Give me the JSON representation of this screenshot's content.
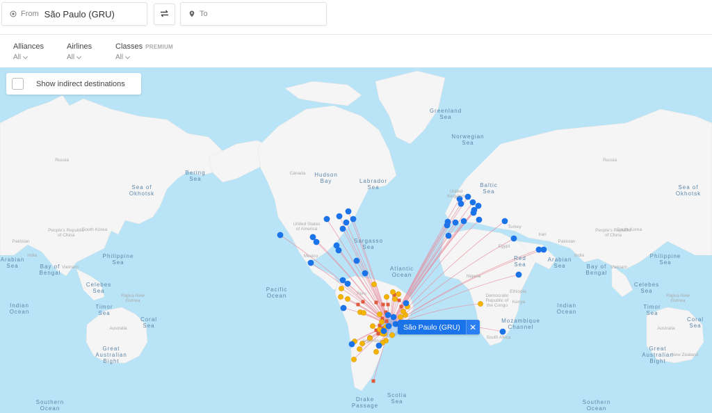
{
  "search": {
    "from_icon": "target-icon",
    "from_label": "From",
    "from_value": "São Paulo (GRU)",
    "swap_icon": "swap-arrows-icon",
    "to_icon": "map-pin-icon",
    "to_placeholder": "To"
  },
  "filters": [
    {
      "title": "Alliances",
      "value": "All",
      "badge": ""
    },
    {
      "title": "Airlines",
      "value": "All",
      "badge": ""
    },
    {
      "title": "Classes",
      "value": "All",
      "badge": "PREMIUM"
    }
  ],
  "map": {
    "indirect_toggle_label": "Show indirect destinations",
    "indirect_checked": false,
    "origin": {
      "label": "São Paulo (GRU)",
      "close_icon": "close-icon"
    },
    "colors": {
      "water": "#b9e3f6",
      "land": "#f5f5f5",
      "route": "#e88a9a",
      "marker_blue": "#1a73e8",
      "marker_yellow": "#f4b400",
      "marker_red": "#dd5a3c",
      "origin": "#1a73e8"
    },
    "sea_labels": [
      {
        "text": "Greenland\nSea"
      },
      {
        "text": "Norwegian\nSea"
      },
      {
        "text": "Baltic\nSea"
      },
      {
        "text": "Hudson\nBay"
      },
      {
        "text": "Labrador\nSea"
      },
      {
        "text": "Bering\nSea"
      },
      {
        "text": "Sea of\nOkhotsk"
      },
      {
        "text": "Sea of\nOkhotsk"
      },
      {
        "text": "Sargasso\nSea"
      },
      {
        "text": "Atlantic\nOcean"
      },
      {
        "text": "Pacific\nOcean"
      },
      {
        "text": "Red\nSea"
      },
      {
        "text": "Arabian\nSea"
      },
      {
        "text": "Arabian\nSea"
      },
      {
        "text": "Bay of\nBengal"
      },
      {
        "text": "Bay of\nBengal"
      },
      {
        "text": "Philippine\nSea"
      },
      {
        "text": "Philippine\nSea"
      },
      {
        "text": "Celebes\nSea"
      },
      {
        "text": "Celebes\nSea"
      },
      {
        "text": "Timor\nSea"
      },
      {
        "text": "Timor\nSea"
      },
      {
        "text": "Coral\nSea"
      },
      {
        "text": "Coral\nSea"
      },
      {
        "text": "Indian\nOcean"
      },
      {
        "text": "Indian\nOcean"
      },
      {
        "text": "Great\nAustralian\nBight"
      },
      {
        "text": "Great\nAustralian\nBight"
      },
      {
        "text": "Mozambique\nChannel"
      },
      {
        "text": "Southern\nOcean"
      },
      {
        "text": "Southern\nOcean"
      },
      {
        "text": "Drake\nPassage"
      },
      {
        "text": "Scotia\nSea"
      }
    ],
    "country_labels": [
      {
        "text": "Russia"
      },
      {
        "text": "Russia"
      },
      {
        "text": "Canada"
      },
      {
        "text": "United States\nof America"
      },
      {
        "text": "Mexico"
      },
      {
        "text": "People's Republic\nof China"
      },
      {
        "text": "People's Republic\nof China"
      },
      {
        "text": "South Korea"
      },
      {
        "text": "South Korea"
      },
      {
        "text": "Pakistan"
      },
      {
        "text": "Pakistan"
      },
      {
        "text": "India"
      },
      {
        "text": "India"
      },
      {
        "text": "Vietnam"
      },
      {
        "text": "Vietnam"
      },
      {
        "text": "Papua New\nGuinea"
      },
      {
        "text": "Papua New\nGuinea"
      },
      {
        "text": "Australia"
      },
      {
        "text": "Australia"
      },
      {
        "text": "New Zealand"
      },
      {
        "text": "United\nKingdom"
      },
      {
        "text": "Turkey"
      },
      {
        "text": "Iran"
      },
      {
        "text": "Egypt"
      },
      {
        "text": "Nigeria"
      },
      {
        "text": "Ethiopia"
      },
      {
        "text": "Kenya"
      },
      {
        "text": "Democratic\nRepublic of\nthe Congo"
      },
      {
        "text": "South Africa"
      },
      {
        "text": "Peru"
      },
      {
        "text": "Argentina"
      }
    ]
  }
}
